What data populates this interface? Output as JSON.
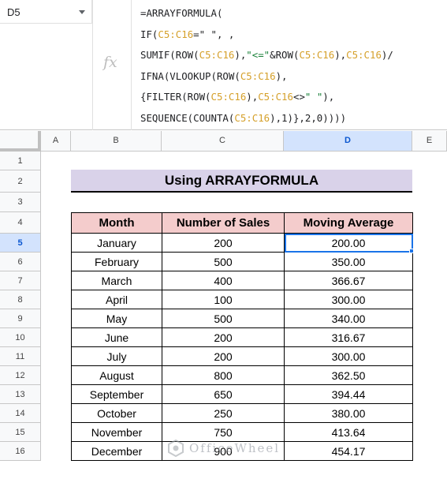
{
  "name_box": {
    "value": "D5"
  },
  "formula_bar": {
    "fx_label": "fx",
    "lines": [
      [
        {
          "t": "=ARRAYFORMULA(",
          "k": "p"
        }
      ],
      [
        {
          "t": "IF(",
          "k": "p"
        },
        {
          "t": "C5:C16",
          "k": "r"
        },
        {
          "t": "=\" \", ,",
          "k": "p"
        }
      ],
      [
        {
          "t": "SUMIF(ROW(",
          "k": "p"
        },
        {
          "t": "C5:C16",
          "k": "r"
        },
        {
          "t": "),",
          "k": "p"
        },
        {
          "t": "\"<=\"",
          "k": "s"
        },
        {
          "t": "&ROW(",
          "k": "p"
        },
        {
          "t": "C5:C16",
          "k": "r"
        },
        {
          "t": "),",
          "k": "p"
        },
        {
          "t": "C5:C16",
          "k": "r"
        },
        {
          "t": ")/",
          "k": "p"
        }
      ],
      [
        {
          "t": "IFNA(VLOOKUP(ROW(",
          "k": "p"
        },
        {
          "t": "C5:C16",
          "k": "r"
        },
        {
          "t": "),",
          "k": "p"
        }
      ],
      [
        {
          "t": "{FILTER(ROW(",
          "k": "p"
        },
        {
          "t": "C5:C16",
          "k": "r"
        },
        {
          "t": "),",
          "k": "p"
        },
        {
          "t": "C5:C16",
          "k": "r"
        },
        {
          "t": "<>",
          "k": "p"
        },
        {
          "t": "\" \"",
          "k": "s"
        },
        {
          "t": "),",
          "k": "p"
        }
      ],
      [
        {
          "t": "SEQUENCE(COUNTA(",
          "k": "p"
        },
        {
          "t": "C5:C16",
          "k": "r"
        },
        {
          "t": "),1)},2,0))))",
          "k": "p"
        }
      ]
    ]
  },
  "columns": [
    "A",
    "B",
    "C",
    "D",
    "E"
  ],
  "selected_column": "D",
  "rows": [
    "1",
    "2",
    "3",
    "4",
    "5",
    "6",
    "7",
    "8",
    "9",
    "10",
    "11",
    "12",
    "13",
    "14",
    "15",
    "16"
  ],
  "selected_row": "5",
  "title": "Using ARRAYFORMULA",
  "table": {
    "headers": [
      "Month",
      "Number of Sales",
      "Moving Average"
    ],
    "rows": [
      [
        "January",
        "200",
        "200.00"
      ],
      [
        "February",
        "500",
        "350.00"
      ],
      [
        "March",
        "400",
        "366.67"
      ],
      [
        "April",
        "100",
        "300.00"
      ],
      [
        "May",
        "500",
        "340.00"
      ],
      [
        "June",
        "200",
        "316.67"
      ],
      [
        "July",
        "200",
        "300.00"
      ],
      [
        "August",
        "800",
        "362.50"
      ],
      [
        "September",
        "650",
        "394.44"
      ],
      [
        "October",
        "250",
        "380.00"
      ],
      [
        "November",
        "750",
        "413.64"
      ],
      [
        "December",
        "900",
        "454.17"
      ]
    ]
  },
  "watermark": {
    "text": "OfficeWheel",
    "icon": "officewheel-logo-icon"
  },
  "colors": {
    "title_bg": "#d9d2e9",
    "header_bg": "#f4cccc",
    "selection": "#1a73e8",
    "ref_color": "#d5a02a",
    "string_color": "#188038"
  }
}
